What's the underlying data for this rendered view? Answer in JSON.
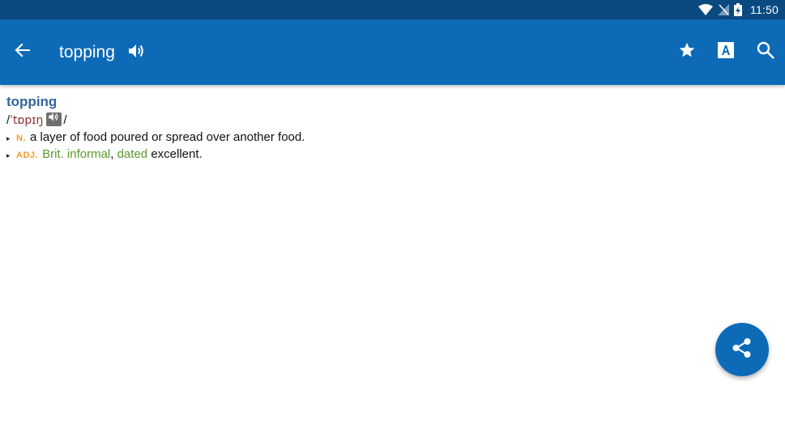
{
  "status_bar": {
    "time": "11:50",
    "icons": [
      "wifi-icon",
      "no-signal-icon",
      "battery-charging-icon"
    ]
  },
  "app_bar": {
    "title": "topping",
    "back_icon": "arrow-left-icon",
    "speaker_icon": "speaker-icon",
    "actions": [
      "star-icon",
      "font-a-icon",
      "search-icon"
    ],
    "color": "#0d6ab7"
  },
  "entry": {
    "headword": "topping",
    "pron_open": "/",
    "pron_ipa": "ˈtɒpɪŋ",
    "pron_close": "/",
    "senses": [
      {
        "bullet": "▸",
        "pos": "N.",
        "definition": "a layer of food poured or spread over another food."
      },
      {
        "bullet": "▸",
        "pos": "ADJ.",
        "label_1": "Brit. informal",
        "separator": ",",
        "label_2": "dated",
        "definition": "excellent."
      }
    ]
  },
  "fab": {
    "icon": "share-icon"
  }
}
